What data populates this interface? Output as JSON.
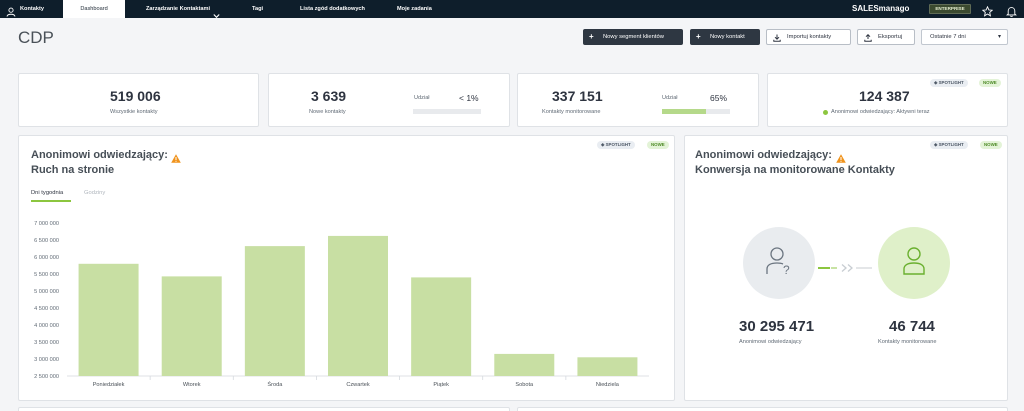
{
  "nav": {
    "items": [
      {
        "label": "Kontakty"
      },
      {
        "label": "Dashboard"
      },
      {
        "label": "Zarządzanie Kontaktami"
      },
      {
        "label": "Tagi"
      },
      {
        "label": "Lista zgód dodatkowych"
      },
      {
        "label": "Moje zadania"
      }
    ],
    "brand": "SALESmanago",
    "plan": "ENTERPRISE"
  },
  "header": {
    "title": "CDP",
    "buttons": [
      {
        "label": "Nowy segment klientów",
        "icon": "plus-icon"
      },
      {
        "label": "Nowy kontakt",
        "icon": "plus-icon"
      },
      {
        "label": "Importuj kontakty",
        "icon": "download-icon"
      },
      {
        "label": "Eksportuj",
        "icon": "upload-icon"
      }
    ],
    "period": "Ostatnie 7 dni"
  },
  "stats": [
    {
      "value": "519 006",
      "caption": "Wszystkie kontakty"
    },
    {
      "value": "3 639",
      "caption": "Nowe kontakty",
      "share_label": "Udział",
      "share_value": "< 1%",
      "share_fraction": 0.0
    },
    {
      "value": "337 151",
      "caption": "Kontakty monitorowane",
      "share_label": "Udział",
      "share_value": "65%",
      "share_fraction": 0.65
    },
    {
      "value": "124 387",
      "caption": "Anonimowi odwiedzający: Aktywni teraz",
      "badges": [
        "SPOTLIGHT",
        "NOWE"
      ]
    }
  ],
  "traffic": {
    "title_line1": "Anonimowi odwiedzający:",
    "title_line2": "Ruch na stronie",
    "badges": [
      "SPOTLIGHT",
      "NOWE"
    ],
    "tabs": [
      "Dni tygodnia",
      "Godziny"
    ],
    "active_tab": 0
  },
  "conversion": {
    "title_line1": "Anonimowi odwiedzający:",
    "title_line2": "Konwersja na monitorowane Kontakty",
    "badges": [
      "SPOTLIGHT",
      "NOWE"
    ],
    "left_value": "30 295 471",
    "left_caption": "Anonimowi odwiedzający",
    "right_value": "46 744",
    "right_caption": "Kontakty monitorowane"
  },
  "colors": {
    "bar": "#c8dfa3",
    "accent": "#8cc63f",
    "nav_bg": "#0e1e2b"
  },
  "chart_data": {
    "type": "bar",
    "categories": [
      "Poniedziałek",
      "Wtorek",
      "Środa",
      "Czwartek",
      "Piątek",
      "Sobota",
      "Niedziela"
    ],
    "values": [
      5800000,
      5430000,
      6320000,
      6620000,
      5400000,
      3150000,
      3050000
    ],
    "ylim": [
      2500000,
      7000000
    ],
    "yticks": [
      2500000,
      3000000,
      3500000,
      4000000,
      4500000,
      5000000,
      5500000,
      6000000,
      6500000,
      7000000
    ],
    "ytick_labels": [
      "2 500 000",
      "3 000 000",
      "3 500 000",
      "4 000 000",
      "4 500 000",
      "5 000 000",
      "5 500 000",
      "6 000 000",
      "6 500 000",
      "7 000 000"
    ],
    "grid": false
  }
}
